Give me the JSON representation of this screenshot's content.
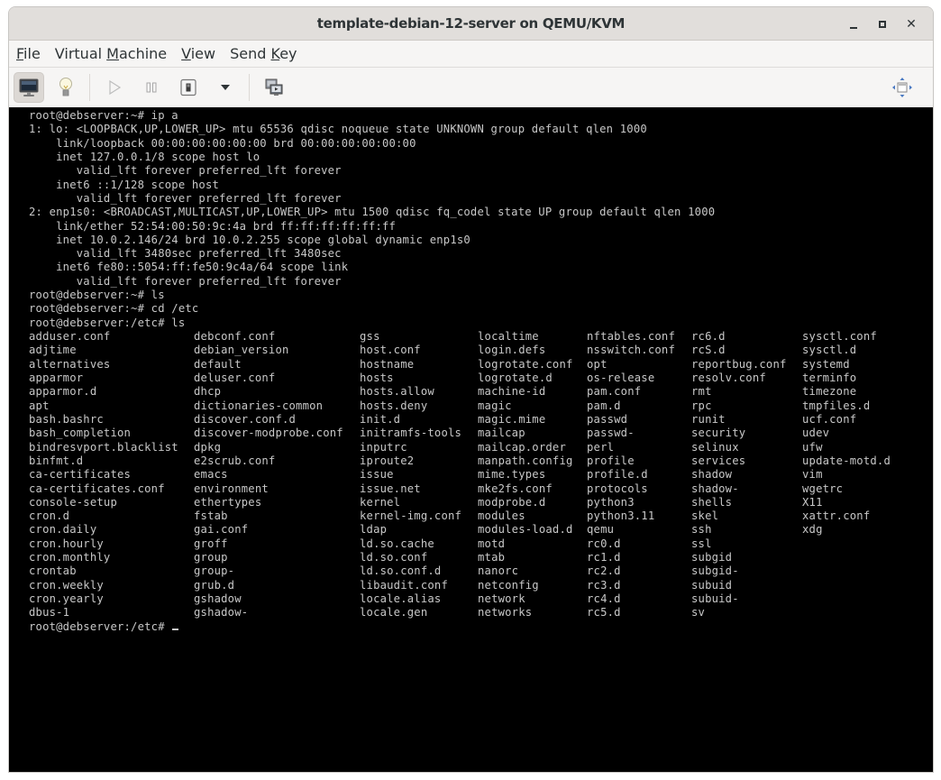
{
  "window": {
    "title": "template-debian-12-server on QEMU/KVM",
    "controls": [
      "minimize",
      "maximize",
      "close"
    ]
  },
  "menubar": {
    "items": [
      {
        "pre": "",
        "mnemonic": "F",
        "post": "ile"
      },
      {
        "pre": "Virtual ",
        "mnemonic": "M",
        "post": "achine"
      },
      {
        "pre": "",
        "mnemonic": "V",
        "post": "iew"
      },
      {
        "pre": "Send ",
        "mnemonic": "K",
        "post": "ey"
      }
    ]
  },
  "toolbar": {
    "buttons": [
      {
        "name": "console-view",
        "icon": "monitor-icon",
        "active": true
      },
      {
        "name": "details-view",
        "icon": "lightbulb-icon",
        "active": false
      },
      {
        "name": "run",
        "icon": "play-icon",
        "active": false
      },
      {
        "name": "pause",
        "icon": "pause-icon",
        "active": false
      },
      {
        "name": "shutdown",
        "icon": "power-switch-icon",
        "active": false
      },
      {
        "name": "shutdown-menu",
        "icon": "dropdown-arrow-icon",
        "active": false
      },
      {
        "name": "snapshots",
        "icon": "snapshots-icon",
        "active": false
      },
      {
        "name": "fullscreen",
        "icon": "resize-icon",
        "active": false
      }
    ]
  },
  "terminal": {
    "lines": [
      "root@debserver:~# ip a",
      "1: lo: <LOOPBACK,UP,LOWER_UP> mtu 65536 qdisc noqueue state UNKNOWN group default qlen 1000",
      "    link/loopback 00:00:00:00:00:00 brd 00:00:00:00:00:00",
      "    inet 127.0.0.1/8 scope host lo",
      "       valid_lft forever preferred_lft forever",
      "    inet6 ::1/128 scope host",
      "       valid_lft forever preferred_lft forever",
      "2: enp1s0: <BROADCAST,MULTICAST,UP,LOWER_UP> mtu 1500 qdisc fq_codel state UP group default qlen 1000",
      "    link/ether 52:54:00:50:9c:4a brd ff:ff:ff:ff:ff:ff",
      "    inet 10.0.2.146/24 brd 10.0.2.255 scope global dynamic enp1s0",
      "       valid_lft 3480sec preferred_lft 3480sec",
      "    inet6 fe80::5054:ff:fe50:9c4a/64 scope link",
      "       valid_lft forever preferred_lft forever",
      "root@debserver:~# ls",
      "root@debserver:~# cd /etc",
      "root@debserver:/etc# ls"
    ],
    "ls_columns": [
      [
        "adduser.conf",
        "adjtime",
        "alternatives",
        "apparmor",
        "apparmor.d",
        "apt",
        "bash.bashrc",
        "bash_completion",
        "bindresvport.blacklist",
        "binfmt.d",
        "ca-certificates",
        "ca-certificates.conf",
        "console-setup",
        "cron.d",
        "cron.daily",
        "cron.hourly",
        "cron.monthly",
        "crontab",
        "cron.weekly",
        "cron.yearly",
        "dbus-1"
      ],
      [
        "debconf.conf",
        "debian_version",
        "default",
        "deluser.conf",
        "dhcp",
        "dictionaries-common",
        "discover.conf.d",
        "discover-modprobe.conf",
        "dpkg",
        "e2scrub.conf",
        "emacs",
        "environment",
        "ethertypes",
        "fstab",
        "gai.conf",
        "groff",
        "group",
        "group-",
        "grub.d",
        "gshadow",
        "gshadow-"
      ],
      [
        "gss",
        "host.conf",
        "hostname",
        "hosts",
        "hosts.allow",
        "hosts.deny",
        "init.d",
        "initramfs-tools",
        "inputrc",
        "iproute2",
        "issue",
        "issue.net",
        "kernel",
        "kernel-img.conf",
        "ldap",
        "ld.so.cache",
        "ld.so.conf",
        "ld.so.conf.d",
        "libaudit.conf",
        "locale.alias",
        "locale.gen"
      ],
      [
        "localtime",
        "login.defs",
        "logrotate.conf",
        "logrotate.d",
        "machine-id",
        "magic",
        "magic.mime",
        "mailcap",
        "mailcap.order",
        "manpath.config",
        "mime.types",
        "mke2fs.conf",
        "modprobe.d",
        "modules",
        "modules-load.d",
        "motd",
        "mtab",
        "nanorc",
        "netconfig",
        "network",
        "networks"
      ],
      [
        "nftables.conf",
        "nsswitch.conf",
        "opt",
        "os-release",
        "pam.conf",
        "pam.d",
        "passwd",
        "passwd-",
        "perl",
        "profile",
        "profile.d",
        "protocols",
        "python3",
        "python3.11",
        "qemu",
        "rc0.d",
        "rc1.d",
        "rc2.d",
        "rc3.d",
        "rc4.d",
        "rc5.d"
      ],
      [
        "rc6.d",
        "rcS.d",
        "reportbug.conf",
        "resolv.conf",
        "rmt",
        "rpc",
        "runit",
        "security",
        "selinux",
        "services",
        "shadow",
        "shadow-",
        "shells",
        "skel",
        "ssh",
        "ssl",
        "subgid",
        "subgid-",
        "subuid",
        "subuid-",
        "sv"
      ],
      [
        "sysctl.conf",
        "sysctl.d",
        "systemd",
        "terminfo",
        "timezone",
        "tmpfiles.d",
        "ucf.conf",
        "udev",
        "ufw",
        "update-motd.d",
        "vim",
        "wgetrc",
        "X11",
        "xattr.conf",
        "xdg"
      ]
    ],
    "prompt": "root@debserver:/etc# "
  }
}
